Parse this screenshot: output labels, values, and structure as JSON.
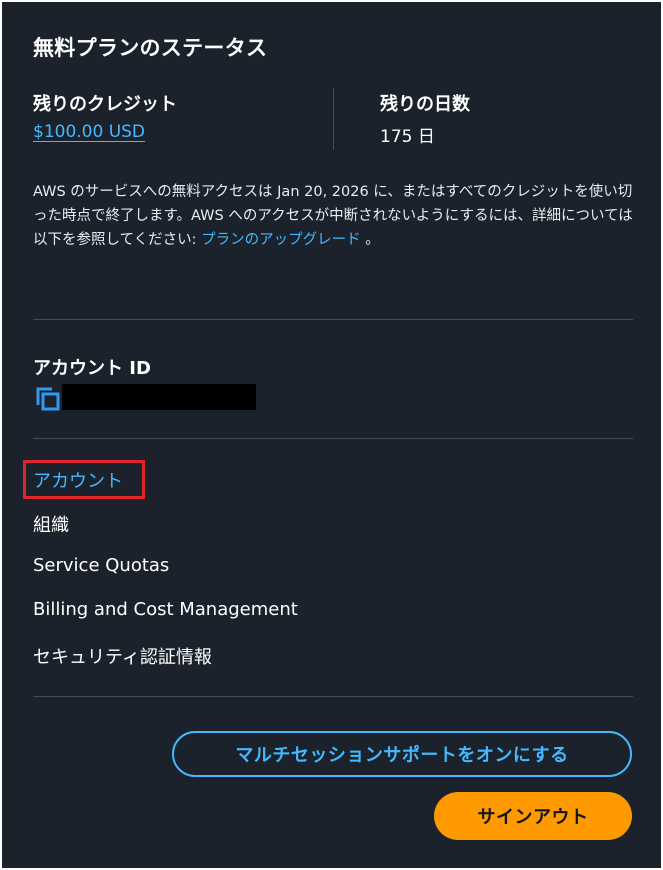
{
  "panel": {
    "title": "無料プランのステータス",
    "credit": {
      "label": "残りのクレジット",
      "value": "$100.00 USD"
    },
    "days": {
      "label": "残りの日数",
      "value": "175 日"
    },
    "description": {
      "text": "AWS のサービスへの無料アクセスは Jan 20, 2026 に、またはすべてのクレジットを使い切った時点で終了します。AWS へのアクセスが中断されないようにするには、詳細については以下を参照してください: ",
      "link": "プランのアップグレード",
      "suffix": " 。"
    }
  },
  "account": {
    "label": "アカウント ID",
    "copy_icon": "copy-icon"
  },
  "menu": {
    "items": [
      {
        "label": "アカウント"
      },
      {
        "label": "組織"
      },
      {
        "label": "Service Quotas"
      },
      {
        "label": "Billing and Cost Management"
      },
      {
        "label": "セキュリティ認証情報"
      }
    ]
  },
  "buttons": {
    "multi_session": "マルチセッションサポートをオンにする",
    "sign_out": "サインアウト"
  },
  "colors": {
    "background": "#1b222c",
    "link": "#44b9ff",
    "primary_button": "#ff9900",
    "highlight": "#e0242c",
    "divider": "#414d5c"
  }
}
